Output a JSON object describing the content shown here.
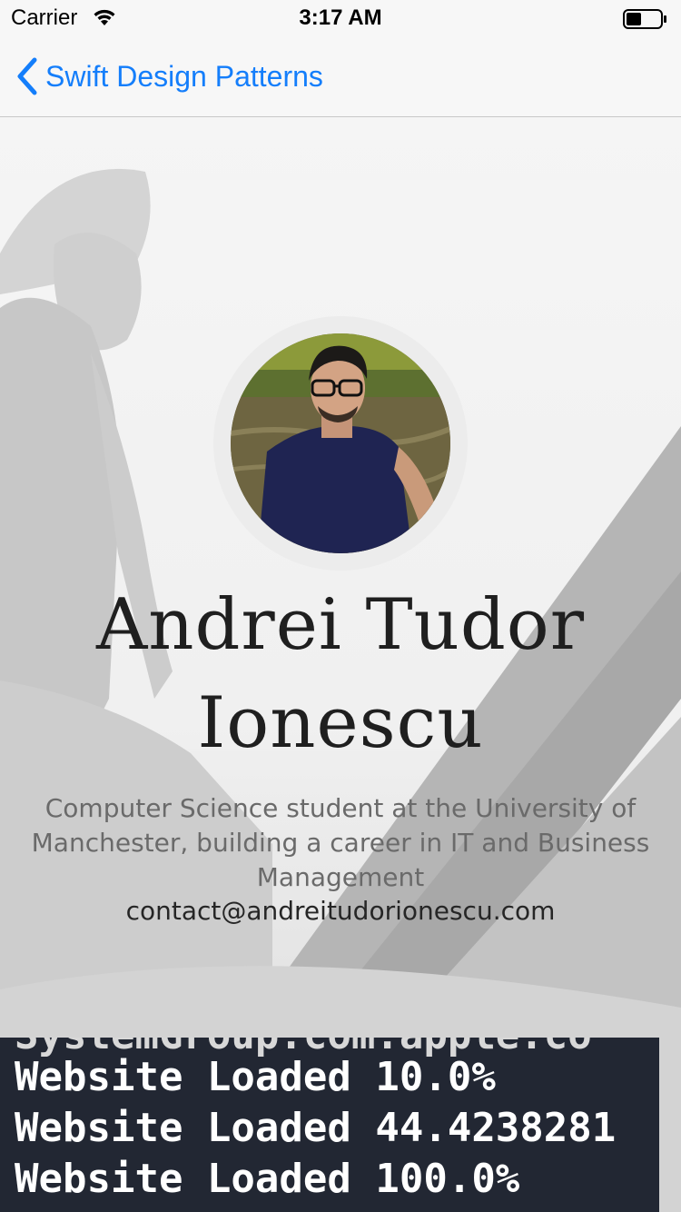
{
  "status_bar": {
    "carrier": "Carrier",
    "time": "3:17 AM",
    "icons": [
      "wifi-icon",
      "battery-icon"
    ]
  },
  "nav": {
    "back_label": "Swift Design Patterns",
    "back_icon": "chevron-left-icon",
    "accent_color": "#147efb"
  },
  "profile": {
    "name": "Andrei Tudor Ionescu",
    "bio": "Computer Science student at the University of Manchester, building a career in IT and Business Management",
    "email": "contact@andreitudorionescu.com"
  },
  "console": {
    "lines": [
      "Website Loaded 10.0%",
      "Website Loaded 44.4238281",
      "Website Loaded 100.0%"
    ],
    "background": "#222733"
  }
}
